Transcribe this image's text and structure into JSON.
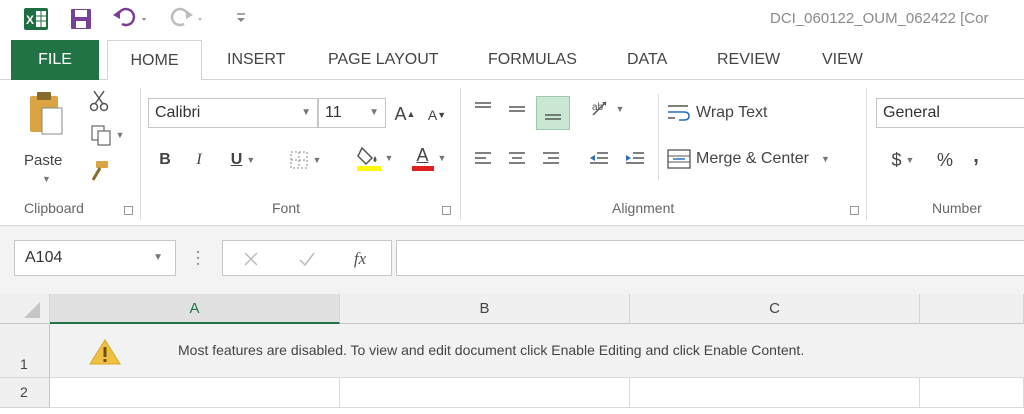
{
  "title_bar": {
    "document_title": "DCI_060122_OUM_062422 [Cor",
    "qat_icons": [
      "excel-logo-icon",
      "save-icon",
      "undo-icon",
      "redo-icon",
      "customize-qat-icon"
    ]
  },
  "tabs": [
    {
      "label": "FILE"
    },
    {
      "label": "HOME"
    },
    {
      "label": "INSERT"
    },
    {
      "label": "PAGE LAYOUT"
    },
    {
      "label": "FORMULAS"
    },
    {
      "label": "DATA"
    },
    {
      "label": "REVIEW"
    },
    {
      "label": "VIEW"
    }
  ],
  "ribbon": {
    "clipboard": {
      "label": "Clipboard",
      "paste_label": "Paste"
    },
    "font": {
      "label": "Font",
      "font_name": "Calibri",
      "font_size": "11",
      "grow_label": "A",
      "shrink_label": "A",
      "bold": "B",
      "italic": "I",
      "underline": "U",
      "font_color_label": "A",
      "highlight_color": "#ffff00",
      "font_color": "#e02020"
    },
    "alignment": {
      "label": "Alignment",
      "wrap_text": "Wrap Text",
      "merge_center": "Merge & Center"
    },
    "number": {
      "label": "Number",
      "format": "General",
      "currency": "$",
      "percent": "%",
      "comma": ","
    }
  },
  "formula_bar": {
    "name_box": "A104",
    "fx_label": "fx",
    "formula": ""
  },
  "grid": {
    "columns": [
      "A",
      "B",
      "C"
    ],
    "rows": [
      "1",
      "2"
    ],
    "warning_message": "Most features are disabled. To view and edit document click Enable Editing and click Enable Content."
  },
  "colors": {
    "excel_green": "#217346",
    "warning_yellow": "#f0c040"
  }
}
